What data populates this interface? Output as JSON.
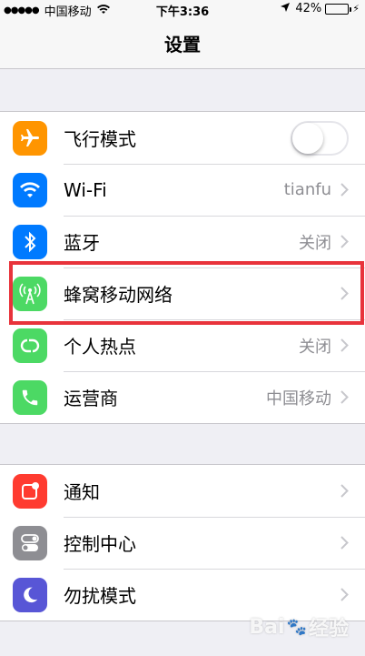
{
  "status_bar": {
    "carrier": "中国移动",
    "time": "下午3:36",
    "battery": "42%",
    "battery_level": 0.42
  },
  "nav": {
    "title": "设置"
  },
  "group1": [
    {
      "label": "飞行模式",
      "icon": "airplane-icon",
      "color": "#ff9500",
      "control": "toggle",
      "toggle_on": false
    },
    {
      "label": "Wi-Fi",
      "icon": "wifi-icon",
      "color": "#007aff",
      "value": "tianfu"
    },
    {
      "label": "蓝牙",
      "icon": "bluetooth-icon",
      "color": "#007aff",
      "value": "关闭"
    },
    {
      "label": "蜂窝移动网络",
      "icon": "cellular-antenna-icon",
      "color": "#4cd964",
      "value": ""
    },
    {
      "label": "个人热点",
      "icon": "hotspot-link-icon",
      "color": "#4cd964",
      "value": "关闭"
    },
    {
      "label": "运营商",
      "icon": "phone-icon",
      "color": "#4cd964",
      "value": "中国移动"
    }
  ],
  "group2": [
    {
      "label": "通知",
      "icon": "notifications-icon",
      "color": "#ff3b30"
    },
    {
      "label": "控制中心",
      "icon": "control-center-icon",
      "color": "#8e8e93"
    },
    {
      "label": "勿扰模式",
      "icon": "moon-icon",
      "color": "#5856d6"
    }
  ],
  "watermark": {
    "left": "Bai",
    "right": "经验"
  }
}
